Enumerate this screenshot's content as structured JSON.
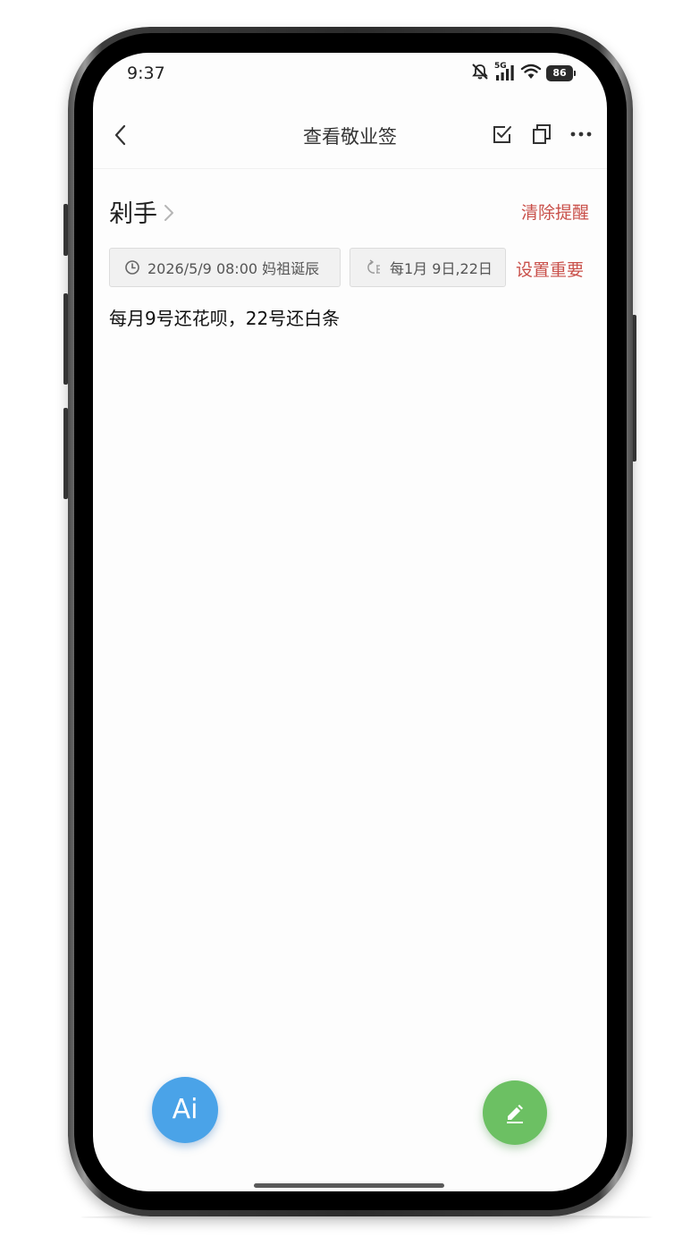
{
  "status_bar": {
    "time": "9:37",
    "network": "5G",
    "battery": "86",
    "icons": [
      "mute-icon",
      "signal-icon",
      "wifi-icon",
      "battery-icon"
    ]
  },
  "nav": {
    "title": "查看敬业签",
    "actions": [
      "check-square-icon",
      "copy-icon",
      "more-icon"
    ]
  },
  "note": {
    "title": "剁手",
    "clear_reminder_label": "清除提醒",
    "reminder_chip": "2026/5/9 08:00 妈祖诞辰",
    "repeat_chip": "每1月 9日,22日",
    "set_important_label": "设置重要",
    "content": "每月9号还花呗，22号还白条"
  },
  "fab": {
    "ai_label": "Ai"
  },
  "colors": {
    "accent_red": "#c9504a",
    "ai_blue": "#4aa3e8",
    "edit_green": "#6cc063"
  }
}
